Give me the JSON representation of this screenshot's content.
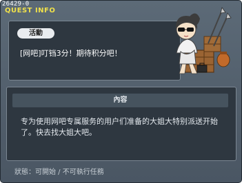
{
  "window": {
    "code": "26429-0",
    "title": "QUEST INFO"
  },
  "quest": {
    "category_label": "活動",
    "headline": "[网吧]叮铛3分！期待积分吧！"
  },
  "content": {
    "section_label": "內容",
    "description": "专为使用网吧专属服务的用户们准备的大姐大特别派送开始了。快去找大姐大吧。"
  },
  "footer": {
    "status": "狀態：可開始 / 不可執行任務"
  },
  "colors": {
    "title": "#f0e14a",
    "window_bg": "#56636f",
    "panel_bg": "#2e3740"
  },
  "icons": {
    "portrait": "npc-portrait-icon"
  }
}
